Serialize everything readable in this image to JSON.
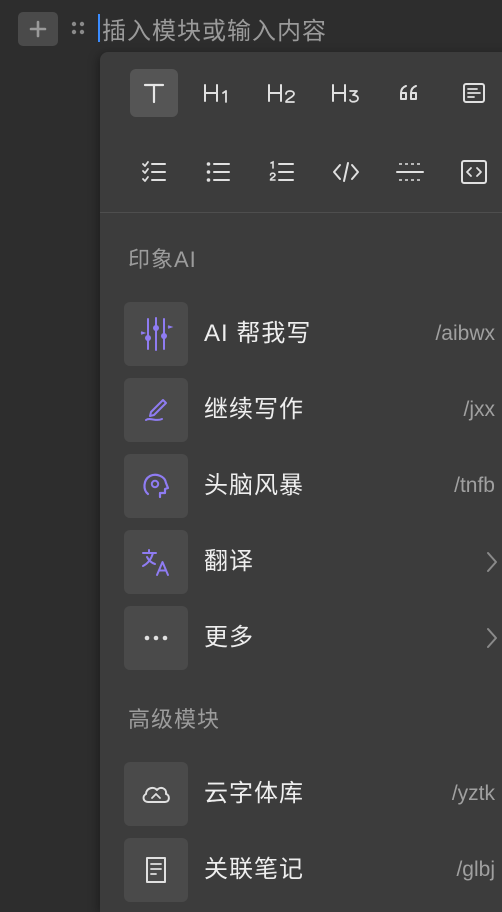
{
  "editor": {
    "placeholder": "插入模块或输入内容"
  },
  "toolbar": {
    "row1": [
      "text-icon",
      "heading-1-icon",
      "heading-2-icon",
      "heading-3-icon",
      "quote-icon",
      "callout-icon"
    ],
    "row2": [
      "checklist-icon",
      "bullet-list-icon",
      "numbered-list-icon",
      "code-icon",
      "divider-icon",
      "embed-code-icon"
    ],
    "active": "text-icon"
  },
  "sections": {
    "ai": {
      "title": "印象AI",
      "items": [
        {
          "label": "AI 帮我写",
          "shortcut": "/aibwx",
          "icon": "ai-sparkle-icon"
        },
        {
          "label": "继续写作",
          "shortcut": "/jxx",
          "icon": "continue-writing-icon"
        },
        {
          "label": "头脑风暴",
          "shortcut": "/tnfb",
          "icon": "brainstorm-icon"
        },
        {
          "label": "翻译",
          "shortcut": "",
          "icon": "translate-icon"
        },
        {
          "label": "更多",
          "shortcut": "",
          "icon": "more-icon"
        }
      ]
    },
    "advanced": {
      "title": "高级模块",
      "items": [
        {
          "label": "云字体库",
          "shortcut": "/yztk",
          "icon": "cloud-icon"
        },
        {
          "label": "关联笔记",
          "shortcut": "/glbj",
          "icon": "linked-note-icon"
        }
      ]
    }
  },
  "colors": {
    "accent_purple": "#8f7cf2",
    "caret_blue": "#3a8cff",
    "background": "#2d2d2d",
    "menu_background": "#3c3c3c"
  }
}
